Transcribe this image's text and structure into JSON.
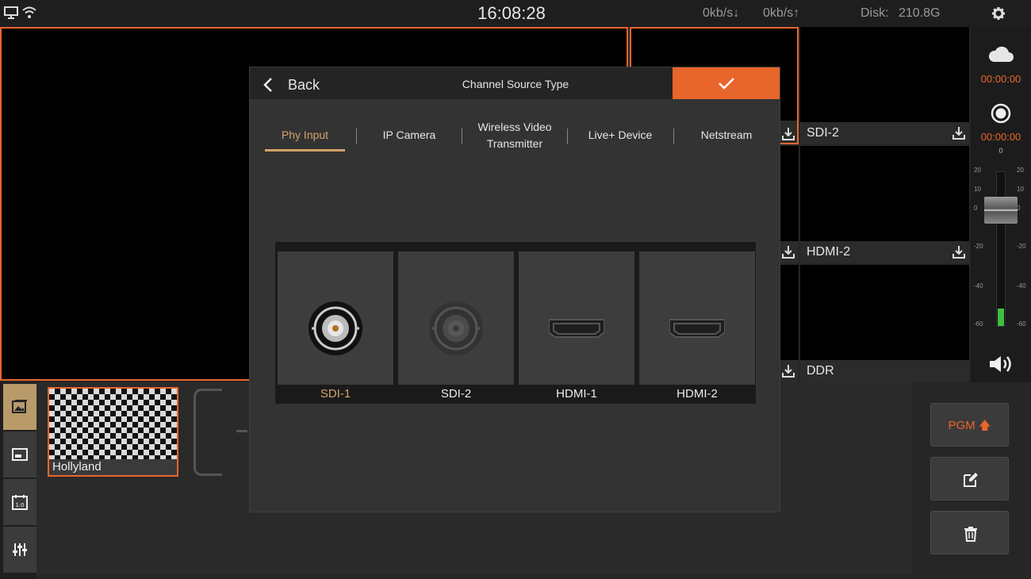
{
  "topbar": {
    "time": "16:08:28",
    "download": "0kb/s↓",
    "upload": "0kb/s↑",
    "disk_label": "Disk:",
    "disk_value": "210.8G"
  },
  "monitors": [
    {
      "label": "SDI-2"
    },
    {
      "label": "HDMI-2"
    },
    {
      "label": "DDR"
    }
  ],
  "audio": {
    "stream_timer": "00:00:00",
    "record_timer": "00:00:00",
    "peak": "0",
    "scale": [
      "20",
      "10",
      "0",
      "-20",
      "-40",
      "-60"
    ],
    "scale_right": [
      "20",
      "10",
      "0",
      "-20",
      "-40",
      "-60"
    ]
  },
  "thumb": {
    "label": "Hollyland"
  },
  "rightpanel": {
    "pgm_label": "PGM"
  },
  "modal": {
    "back_label": "Back",
    "title": "Channel Source Type",
    "tabs": [
      {
        "label": "Phy Input"
      },
      {
        "label": "IP Camera"
      },
      {
        "label": "Wireless Video Transmitter"
      },
      {
        "label": "Live+ Device"
      },
      {
        "label": "Netstream"
      }
    ],
    "active_tab": "Phy Input",
    "sources": [
      {
        "label": "SDI-1",
        "type": "sdi",
        "selected": true
      },
      {
        "label": "SDI-2",
        "type": "sdi",
        "selected": false
      },
      {
        "label": "HDMI-1",
        "type": "hdmi",
        "selected": false
      },
      {
        "label": "HDMI-2",
        "type": "hdmi",
        "selected": false
      }
    ]
  },
  "colors": {
    "accent": "#e8652b",
    "tab_active": "#d4a26a",
    "background": "#262626"
  }
}
